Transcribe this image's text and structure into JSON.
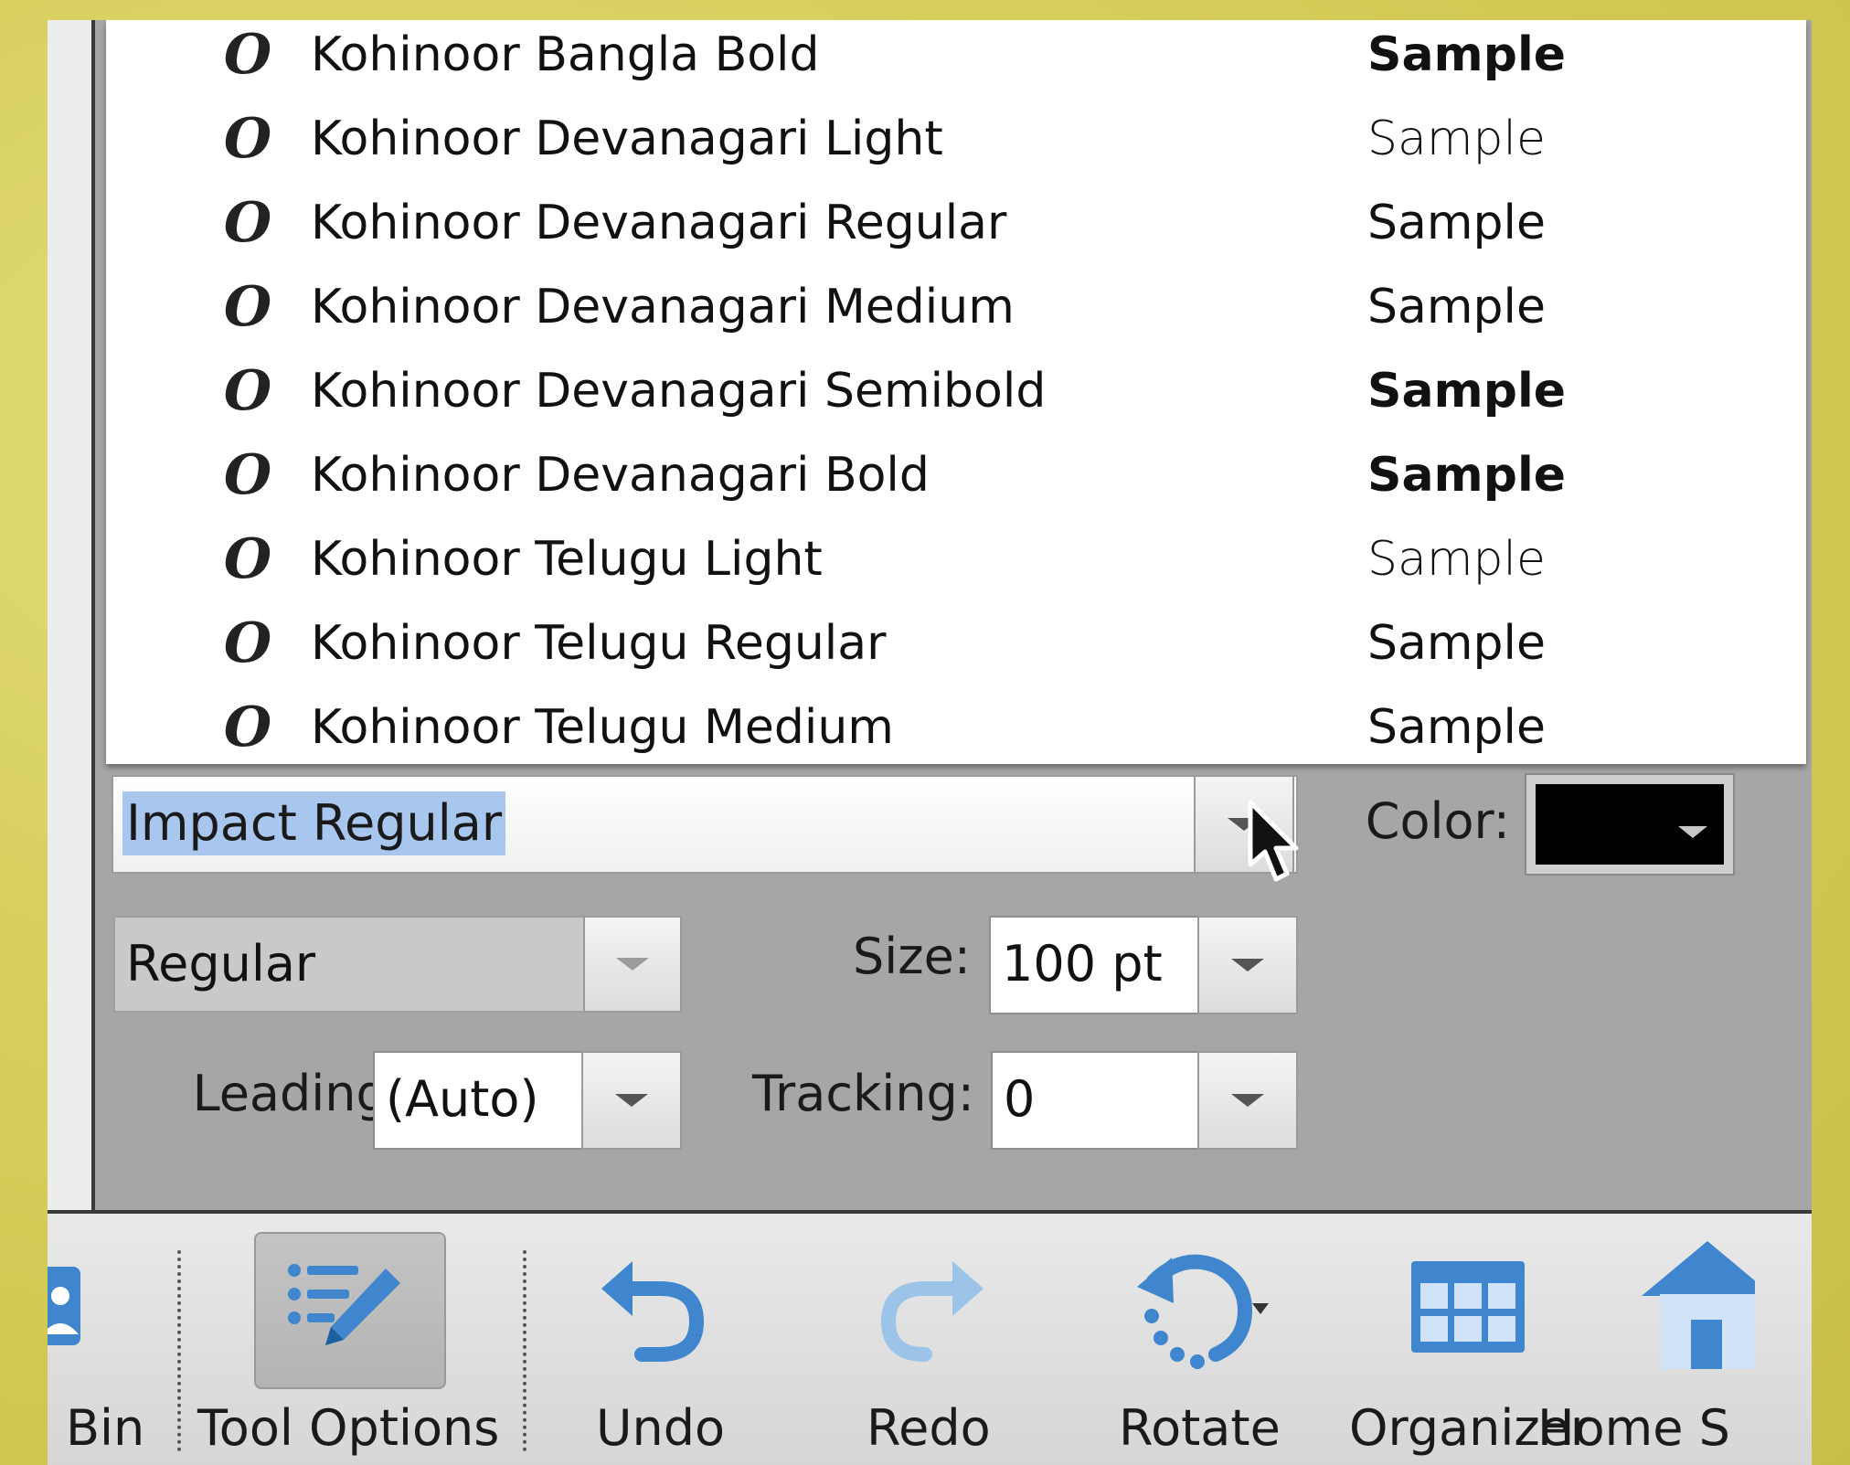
{
  "font_list": {
    "items": [
      {
        "name": "Kohinoor Bangla Bold",
        "sample": "Sample",
        "weight": "bold",
        "icon": "opentype-font-icon"
      },
      {
        "name": "Kohinoor Devanagari Light",
        "sample": "Sample",
        "weight": "light",
        "icon": "opentype-font-icon"
      },
      {
        "name": "Kohinoor Devanagari Regular",
        "sample": "Sample",
        "weight": "regular",
        "icon": "opentype-font-icon"
      },
      {
        "name": "Kohinoor Devanagari Medium",
        "sample": "Sample",
        "weight": "medium",
        "icon": "opentype-font-icon"
      },
      {
        "name": "Kohinoor Devanagari Semibold",
        "sample": "Sample",
        "weight": "semibold",
        "icon": "opentype-font-icon"
      },
      {
        "name": "Kohinoor Devanagari Bold",
        "sample": "Sample",
        "weight": "bold",
        "icon": "opentype-font-icon"
      },
      {
        "name": "Kohinoor Telugu Light",
        "sample": "Sample",
        "weight": "light",
        "icon": "opentype-font-icon"
      },
      {
        "name": "Kohinoor Telugu Regular",
        "sample": "Sample",
        "weight": "regular",
        "icon": "opentype-font-icon"
      },
      {
        "name": "Kohinoor Telugu Medium",
        "sample": "Sample",
        "weight": "medium",
        "icon": "opentype-font-icon"
      }
    ]
  },
  "controls": {
    "font_family_value": "Impact Regular",
    "color_label": "Color:",
    "color_value": "#000000",
    "font_style_value": "Regular",
    "size_label": "Size:",
    "size_value": "100 pt",
    "leading_label": "Leading:",
    "leading_value": "(Auto)",
    "tracking_label": "Tracking:",
    "tracking_value": "0"
  },
  "taskbar": {
    "items": [
      {
        "label": "Bin",
        "icon": "photo-bin-icon"
      },
      {
        "label": "Tool Options",
        "icon": "tool-options-icon"
      },
      {
        "label": "Undo",
        "icon": "undo-icon"
      },
      {
        "label": "Redo",
        "icon": "redo-icon"
      },
      {
        "label": "Rotate",
        "icon": "rotate-icon"
      },
      {
        "label": "Organizer",
        "icon": "organizer-icon"
      },
      {
        "label": "Home S",
        "icon": "home-icon"
      }
    ]
  },
  "colors": {
    "selection_highlight": "#a8c6ee",
    "icon_blue": "#3f86cf",
    "panel_gray": "#a6a6a6"
  }
}
